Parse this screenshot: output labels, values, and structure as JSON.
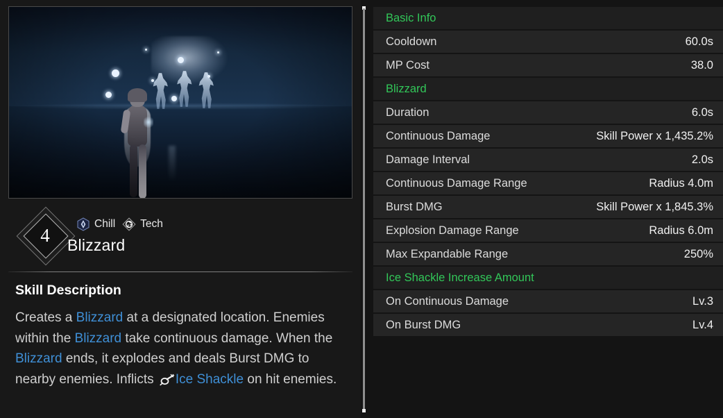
{
  "skill": {
    "level": "4",
    "name": "Blizzard",
    "tags": [
      {
        "label": "Chill",
        "icon": "chill-icon"
      },
      {
        "label": "Tech",
        "icon": "tech-icon"
      }
    ]
  },
  "description": {
    "heading": "Skill Description",
    "segments": [
      {
        "text": "Creates a ",
        "kind": "plain"
      },
      {
        "text": "Blizzard",
        "kind": "keyword"
      },
      {
        "text": " at a designated location. Enemies within the ",
        "kind": "plain"
      },
      {
        "text": "Blizzard",
        "kind": "keyword"
      },
      {
        "text": " take continuous damage. When the ",
        "kind": "plain"
      },
      {
        "text": "Blizzard",
        "kind": "keyword"
      },
      {
        "text": " ends, it explodes and deals Burst DMG to nearby enemies. Inflicts ",
        "kind": "plain"
      },
      {
        "text": "",
        "kind": "icon",
        "icon": "ice-shackle-icon"
      },
      {
        "text": "Ice Shackle",
        "kind": "keyword"
      },
      {
        "text": " on hit enemies.",
        "kind": "plain"
      }
    ],
    "plain_text": "Creates a Blizzard at a designated location. Enemies within the Blizzard take continuous damage. When the Blizzard ends, it explodes and deals Burst DMG to nearby enemies. Inflicts Ice Shackle on hit enemies."
  },
  "preview": {
    "name": "skill-preview-video",
    "caption": ""
  },
  "stats": [
    {
      "type": "section",
      "label": "Basic Info"
    },
    {
      "type": "row",
      "label": "Cooldown",
      "value": "60.0s"
    },
    {
      "type": "row",
      "label": "MP Cost",
      "value": "38.0"
    },
    {
      "type": "section",
      "label": "Blizzard"
    },
    {
      "type": "row",
      "label": "Duration",
      "value": "6.0s"
    },
    {
      "type": "row",
      "label": "Continuous Damage",
      "value": "Skill Power x 1,435.2%"
    },
    {
      "type": "row",
      "label": "Damage Interval",
      "value": "2.0s"
    },
    {
      "type": "row",
      "label": "Continuous Damage Range",
      "value": "Radius 4.0m"
    },
    {
      "type": "row",
      "label": "Burst DMG",
      "value": "Skill Power x 1,845.3%"
    },
    {
      "type": "row",
      "label": "Explosion Damage Range",
      "value": "Radius 6.0m"
    },
    {
      "type": "row",
      "label": "Max Expandable Range",
      "value": "250%"
    },
    {
      "type": "section",
      "label": "Ice Shackle Increase Amount"
    },
    {
      "type": "row",
      "label": "On Continuous Damage",
      "value": "Lv.3"
    },
    {
      "type": "row",
      "label": "On Burst DMG",
      "value": "Lv.4"
    }
  ],
  "colors": {
    "section_header": "#32c759",
    "keyword": "#3f8fd6",
    "row_bg": "#252525",
    "panel_bg": "#141414",
    "value_text": "#f0f0f0"
  }
}
